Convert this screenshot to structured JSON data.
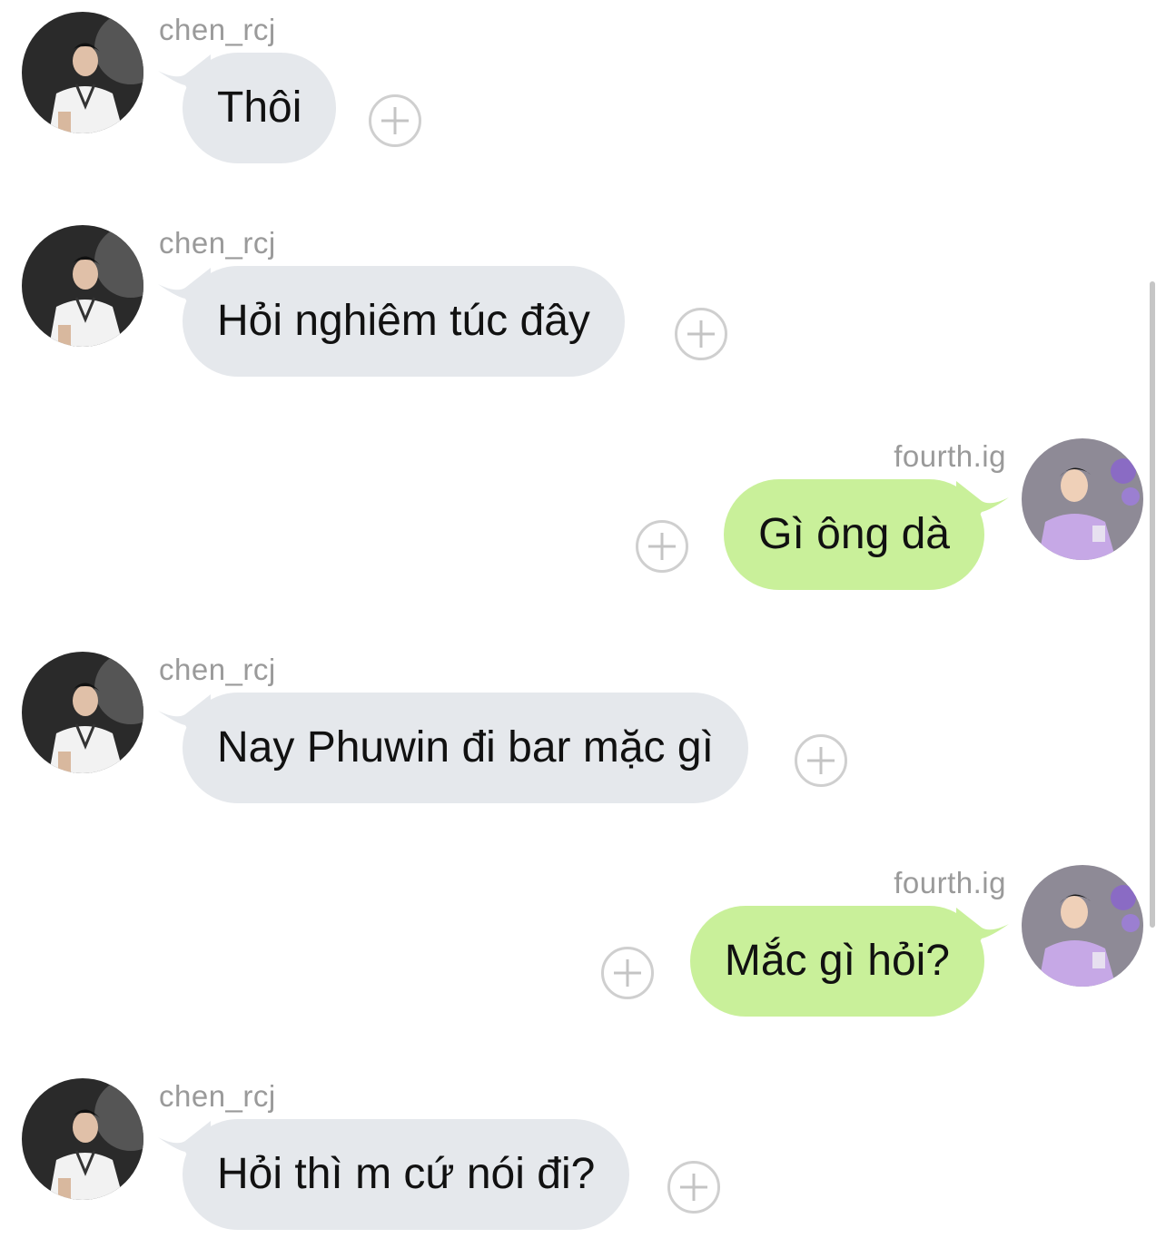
{
  "messages": [
    {
      "direction": "in",
      "username": "chen_rcj",
      "text": "Thôi",
      "avatar": "avatar-chen"
    },
    {
      "direction": "in",
      "username": "chen_rcj",
      "text": "Hỏi nghiêm túc đây",
      "avatar": "avatar-chen"
    },
    {
      "direction": "out",
      "username": "fourth.ig",
      "text": "Gì ông dà",
      "avatar": "avatar-fourth"
    },
    {
      "direction": "in",
      "username": "chen_rcj",
      "text": "Nay Phuwin đi bar mặc gì",
      "avatar": "avatar-chen"
    },
    {
      "direction": "out",
      "username": "fourth.ig",
      "text": "Mắc gì hỏi?",
      "avatar": "avatar-fourth"
    },
    {
      "direction": "in",
      "username": "chen_rcj",
      "text": "Hỏi thì m cứ nói đi?",
      "avatar": "avatar-chen"
    }
  ],
  "colors": {
    "incoming_bubble": "#e5e8ec",
    "outgoing_bubble": "#c9f09a",
    "username": "#9a9a9a",
    "text": "#111111"
  },
  "icons": {
    "reaction_button": "plus-circle-icon"
  }
}
